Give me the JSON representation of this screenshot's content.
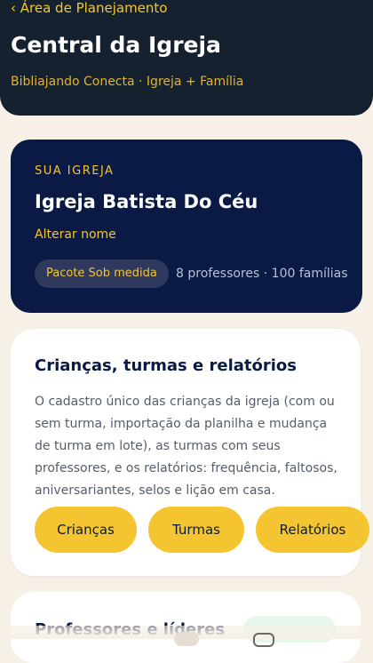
{
  "header": {
    "back_label": "‹ Área de Planejamento",
    "title": "Central da Igreja",
    "subtitle": "Bibliajando Conecta · Igreja + Família"
  },
  "church": {
    "eyebrow": "SUA IGREJA",
    "name": "Igreja Batista Do Céu",
    "rename_label": "Alterar nome",
    "plan_badge": "Pacote Sob medida",
    "plan_stats": "8 professores · 100 famílias"
  },
  "section": {
    "title": "Crianças, turmas e relatórios",
    "description": "O cadastro único das crianças da igreja (com ou sem turma, importação da planilha e mudança de turma em lote), as turmas com seus professores, e os relatórios: frequência, faltosos, aniversariantes, selos e lição em casa.",
    "buttons": [
      "Crianças",
      "Turmas",
      "Relatórios"
    ]
  },
  "next_section": {
    "title": "Professores e líderes"
  },
  "colors": {
    "header_bg": "#16212f",
    "accent": "#f4c530",
    "card_navy": "#0b1a44",
    "page_bg": "#f6f0e6"
  }
}
